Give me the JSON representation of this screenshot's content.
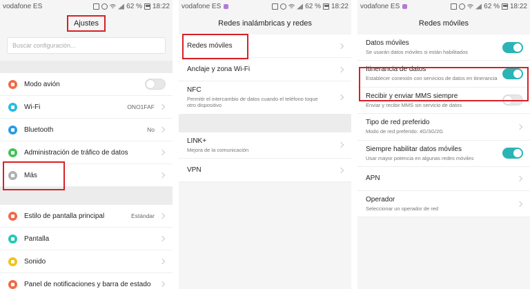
{
  "colors": {
    "highlight": "#d61f26",
    "toggle_on": "#2ab4b5",
    "toggle_off": "#e7e7e7"
  },
  "status": {
    "carrier": "vodafone ES",
    "battery": "62 %",
    "time": "18:22"
  },
  "screen1": {
    "title": "Ajustes",
    "search_placeholder": "Buscar configuración...",
    "group1": [
      {
        "label": "Modo avión",
        "icon": "airplane-icon",
        "color": "#f06a4a",
        "toggle": "off"
      },
      {
        "label": "Wi-Fi",
        "icon": "wifi-icon",
        "color": "#28bde0",
        "value": "ONO1FAF"
      },
      {
        "label": "Bluetooth",
        "icon": "bluetooth-icon",
        "color": "#2a9be8",
        "value": "No"
      },
      {
        "label": "Administración de tráfico de datos",
        "icon": "data-usage-icon",
        "color": "#43c257"
      },
      {
        "label": "Más",
        "icon": "more-icon",
        "color": "#b0b0b0"
      }
    ],
    "group2": [
      {
        "label": "Estilo de pantalla principal",
        "icon": "home-style-icon",
        "color": "#f06a4a",
        "value": "Estándar"
      },
      {
        "label": "Pantalla",
        "icon": "display-icon",
        "color": "#27c7b9"
      },
      {
        "label": "Sonido",
        "icon": "sound-icon",
        "color": "#f2c21b"
      },
      {
        "label": "Panel de notificaciones y barra de estado",
        "icon": "notification-panel-icon",
        "color": "#f06a4a"
      }
    ]
  },
  "screen2": {
    "title": "Redes inalámbricas y redes",
    "group1": [
      {
        "label": "Redes móviles"
      },
      {
        "label": "Anclaje y zona Wi-Fi"
      },
      {
        "label": "NFC",
        "sub": "Permitir el intercambio de datos cuando el teléfono toque otro dispositivo"
      }
    ],
    "group2": [
      {
        "label": "LINK+",
        "sub": "Mejora de la comunicación"
      },
      {
        "label": "VPN"
      }
    ]
  },
  "screen3": {
    "title": "Redes móviles",
    "items": [
      {
        "label": "Datos móviles",
        "sub": "Se usarán datos móviles si están habilitados",
        "toggle": "on"
      },
      {
        "label": "Itinerancia de datos",
        "sub": "Establecer conexión con servicios de datos en itinerancia",
        "toggle": "on"
      },
      {
        "label": "Recibir y enviar MMS siempre",
        "sub": "Enviar y recibir MMS sin servicio de datos",
        "toggle": "off"
      },
      {
        "label": "Tipo de red preferido",
        "sub": "Modo de red preferido: 4G/3G/2G"
      },
      {
        "label": "Siempre habilitar datos móviles",
        "sub": "Usar mayor potencia en algunas redes móviles",
        "toggle": "on"
      },
      {
        "label": "APN"
      },
      {
        "label": "Operador",
        "sub": "Seleccionar un operador de red"
      }
    ]
  }
}
